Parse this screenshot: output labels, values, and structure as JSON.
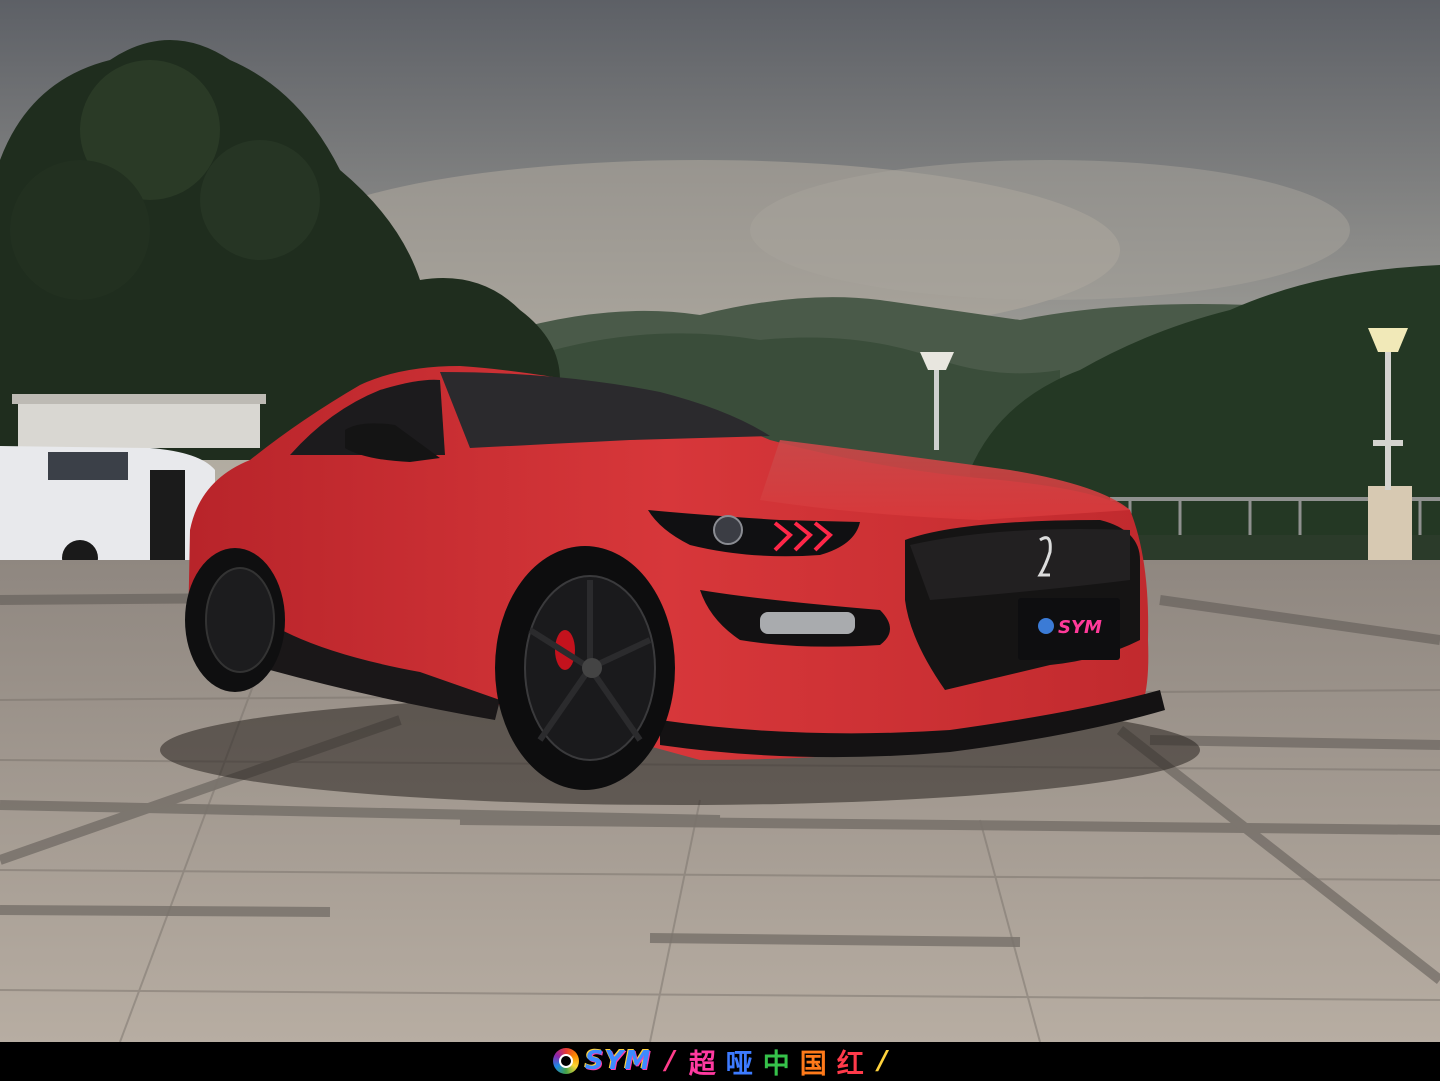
{
  "image": {
    "subject": "car",
    "scene": "plaza"
  },
  "caption": {
    "brand": "SYM",
    "separator_left": "/",
    "separator_right": "/",
    "slogan_chars": [
      "超",
      "哑",
      "中",
      "国",
      "红"
    ],
    "slogan_colors": [
      "#ff3aa0",
      "#3d7bff",
      "#36c24a",
      "#ff7a1a",
      "#ff3a4a"
    ]
  },
  "plate": {
    "brand": "SYM"
  }
}
